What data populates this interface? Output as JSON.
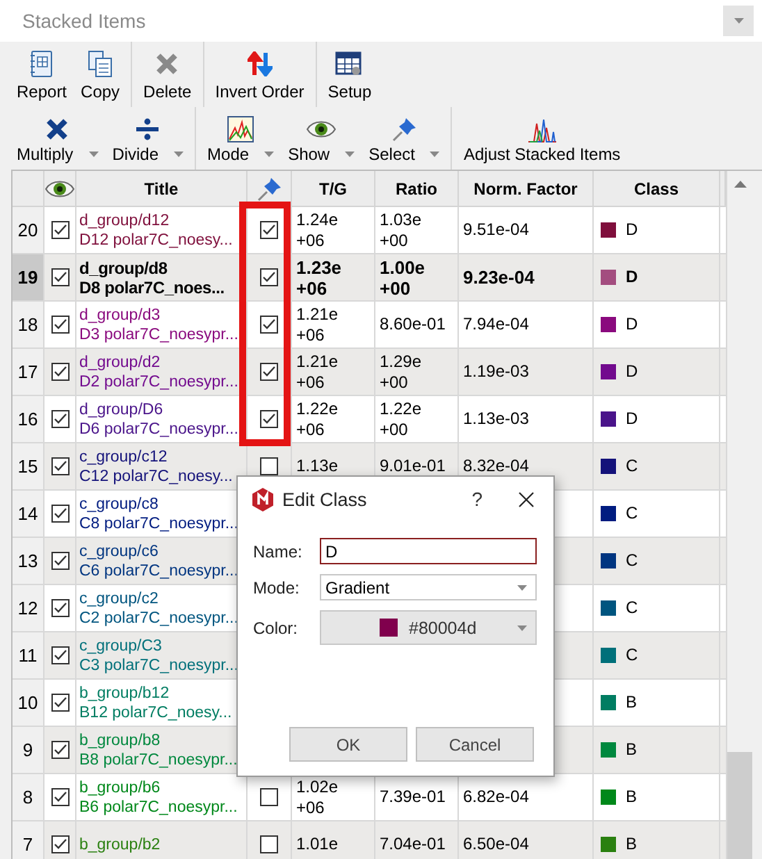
{
  "window": {
    "title": "Stacked Items"
  },
  "toolbar": {
    "rows": [
      {
        "groups": [
          {
            "buttons": [
              {
                "label": "Report",
                "kind": "report",
                "dropdown": false
              },
              {
                "label": "Copy",
                "kind": "copy",
                "dropdown": false
              }
            ]
          },
          {
            "buttons": [
              {
                "label": "Delete",
                "kind": "delete",
                "dropdown": false
              }
            ]
          },
          {
            "buttons": [
              {
                "label": "Invert Order",
                "kind": "invert",
                "dropdown": false
              }
            ]
          },
          {
            "buttons": [
              {
                "label": "Setup",
                "kind": "setup",
                "dropdown": false
              }
            ]
          }
        ]
      },
      {
        "groups": [
          {
            "buttons": [
              {
                "label": "Multiply",
                "kind": "multiply",
                "dropdown": true
              },
              {
                "label": "Divide",
                "kind": "divide",
                "dropdown": true
              }
            ]
          },
          {
            "buttons": [
              {
                "label": "Mode",
                "kind": "mode",
                "dropdown": true
              },
              {
                "label": "Show",
                "kind": "show",
                "dropdown": true
              },
              {
                "label": "Select",
                "kind": "select",
                "dropdown": true
              }
            ]
          },
          {
            "buttons": [
              {
                "label": "Adjust Stacked Items",
                "kind": "adjust",
                "dropdown": false
              }
            ]
          }
        ]
      }
    ]
  },
  "table": {
    "columns": [
      {
        "kind": "number"
      },
      {
        "kind": "visibility"
      },
      {
        "kind": "text",
        "label": "Title"
      },
      {
        "kind": "pin"
      },
      {
        "kind": "text",
        "label": "T/G"
      },
      {
        "kind": "text",
        "label": "Ratio"
      },
      {
        "kind": "text",
        "label": "Norm. Factor"
      },
      {
        "kind": "text",
        "label": "Class"
      }
    ],
    "rows": [
      {
        "number": "20",
        "visible": true,
        "selected": false,
        "title": "d_group/d12",
        "subtitle": "D12 polar7C_noesy...",
        "color": "#7f0f3c",
        "pinned": true,
        "tg": "1.24e+06",
        "ratio": "1.03e+00",
        "norm": "9.51e-04",
        "class": "D"
      },
      {
        "number": "19",
        "visible": true,
        "selected": true,
        "title": "d_group/d8",
        "subtitle": "D8 polar7C_noes...",
        "color": "#a34d7f",
        "pinned": true,
        "tg": "1.23e+06",
        "ratio": "1.00e+00",
        "norm": "9.23e-04",
        "class": "D"
      },
      {
        "number": "18",
        "visible": true,
        "selected": false,
        "title": "d_group/d3",
        "subtitle": "D3 polar7C_noesypr...",
        "color": "#8a0a7e",
        "pinned": true,
        "tg": "1.21e+06",
        "ratio": "8.60e-01",
        "norm": "7.94e-04",
        "class": "D"
      },
      {
        "number": "17",
        "visible": true,
        "selected": false,
        "title": "d_group/d2",
        "subtitle": "D2 polar7C_noesypr...",
        "color": "#720a8e",
        "pinned": true,
        "tg": "1.21e+06",
        "ratio": "1.29e+00",
        "norm": "1.19e-03",
        "class": "D"
      },
      {
        "number": "16",
        "visible": true,
        "selected": false,
        "title": "d_group/D6",
        "subtitle": "D6 polar7C_noesypr...",
        "color": "#4a148a",
        "pinned": true,
        "tg": "1.22e+06",
        "ratio": "1.22e+00",
        "norm": "1.13e-03",
        "class": "D"
      },
      {
        "number": "15",
        "visible": true,
        "selected": false,
        "title": "c_group/c12",
        "subtitle": "C12 polar7C_noesy...",
        "color": "#14127a",
        "pinned": false,
        "tg": "1.13e",
        "ratio": "9.01e-01",
        "norm": "8.32e-04",
        "class": "C"
      },
      {
        "number": "14",
        "visible": true,
        "selected": false,
        "title": "c_group/c8",
        "subtitle": "C8 polar7C_noesypr...",
        "color": "#001c80",
        "class": "C"
      },
      {
        "number": "13",
        "visible": true,
        "selected": false,
        "title": "c_group/c6",
        "subtitle": "C6 polar7C_noesypr...",
        "color": "#003580",
        "class": "C"
      },
      {
        "number": "12",
        "visible": true,
        "selected": false,
        "title": "c_group/c2",
        "subtitle": "C2 polar7C_noesypr...",
        "color": "#00557f",
        "class": "C"
      },
      {
        "number": "11",
        "visible": true,
        "selected": false,
        "title": "c_group/C3",
        "subtitle": "C3 polar7C_noesypr...",
        "color": "#00707a",
        "class": "C"
      },
      {
        "number": "10",
        "visible": true,
        "selected": false,
        "title": "b_group/b12",
        "subtitle": "B12 polar7C_noesy...",
        "color": "#007d62",
        "class": "B"
      },
      {
        "number": "9",
        "visible": true,
        "selected": false,
        "title": "b_group/b8",
        "subtitle": "B8 polar7C_noesypr...",
        "color": "#00883e",
        "class": "B"
      },
      {
        "number": "8",
        "visible": true,
        "selected": false,
        "title": "b_group/b6",
        "subtitle": "B6 polar7C_noesypr...",
        "color": "#00881a",
        "pinned": false,
        "tg": "1.02e+06",
        "ratio": "7.39e-01",
        "norm": "6.82e-04",
        "class": "B"
      },
      {
        "number": "7",
        "visible": true,
        "selected": false,
        "title": "b_group/b2",
        "color": "#2a8010",
        "pinned": false,
        "tg": "1.01e",
        "ratio": "7.04e-01",
        "norm": "6.50e-04",
        "class": "B"
      }
    ]
  },
  "dialog": {
    "title": "Edit Class",
    "help": "?",
    "fields": [
      {
        "kind": "text",
        "label": "Name:",
        "value": "D"
      },
      {
        "kind": "select",
        "label": "Mode:",
        "value": "Gradient"
      },
      {
        "kind": "color",
        "label": "Color:",
        "value": "#80004d",
        "color": "#80004d"
      }
    ],
    "buttons": [
      "OK",
      "Cancel"
    ]
  }
}
